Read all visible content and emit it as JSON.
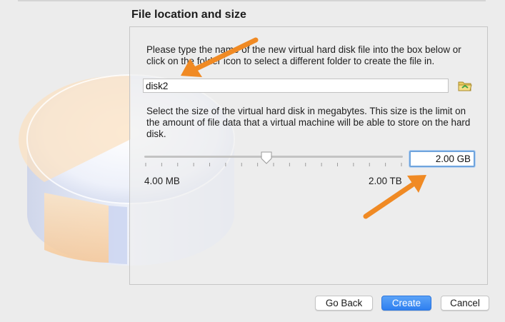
{
  "section": {
    "title": "File location and size"
  },
  "file": {
    "description": "Please type the name of the new virtual hard disk file into the box below or click on the folder icon to select a different folder to create the file in.",
    "name_value": "disk2",
    "folder_icon": "folder-icon"
  },
  "size": {
    "description": "Select the size of the virtual hard disk in megabytes. This size is the limit on the amount of file data that a virtual machine will be able to store on the hard disk.",
    "slider_position": 0.47,
    "min_label": "4.00 MB",
    "max_label": "2.00 TB",
    "value": "2.00 GB"
  },
  "buttons": {
    "go_back": "Go Back",
    "create": "Create",
    "cancel": "Cancel"
  },
  "colors": {
    "accent": "#3b8ef5",
    "annotation_arrow": "#f08a24"
  }
}
